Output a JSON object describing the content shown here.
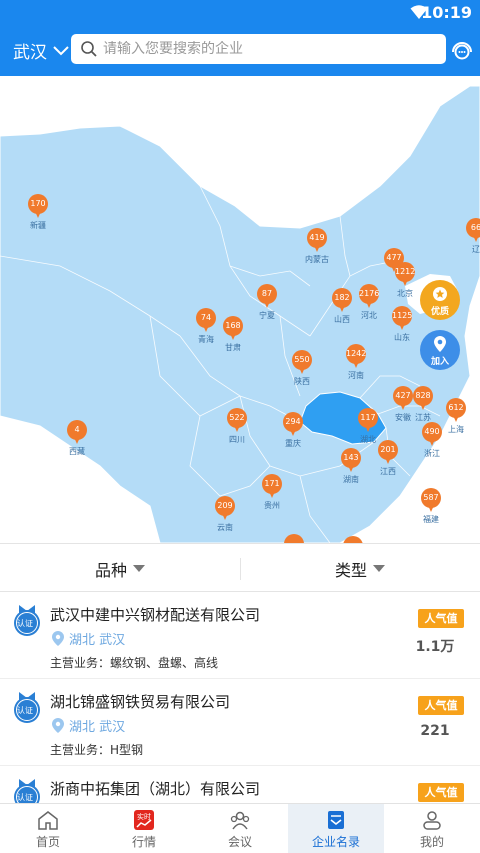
{
  "status": {
    "time": "10:19"
  },
  "header": {
    "city": "武汉",
    "search_placeholder": "请输入您要搜索的企业"
  },
  "map": {
    "pins": [
      {
        "value": "170",
        "label": "新疆"
      },
      {
        "value": "419",
        "label": "内蒙古"
      },
      {
        "value": "66",
        "label": "辽"
      },
      {
        "value": "477",
        "label": ""
      },
      {
        "value": "1212",
        "label": "北京"
      },
      {
        "value": "87",
        "label": "宁夏"
      },
      {
        "value": "182",
        "label": "山西"
      },
      {
        "value": "2176",
        "label": "河北"
      },
      {
        "value": "74",
        "label": "青海"
      },
      {
        "value": "168",
        "label": "甘肃"
      },
      {
        "value": "1125",
        "label": "山东"
      },
      {
        "value": "550",
        "label": "陕西"
      },
      {
        "value": "1242",
        "label": "河南"
      },
      {
        "value": "427",
        "label": "安徽"
      },
      {
        "value": "828",
        "label": "江苏"
      },
      {
        "value": "612",
        "label": "上海"
      },
      {
        "value": "522",
        "label": "四川"
      },
      {
        "value": "294",
        "label": "重庆"
      },
      {
        "value": "117",
        "label": "湖北"
      },
      {
        "value": "4",
        "label": "西藏"
      },
      {
        "value": "201",
        "label": "江西"
      },
      {
        "value": "490",
        "label": "浙江"
      },
      {
        "value": "143",
        "label": "湖南"
      },
      {
        "value": "171",
        "label": "贵州"
      },
      {
        "value": "209",
        "label": "云南"
      },
      {
        "value": "587",
        "label": "福建"
      }
    ],
    "quality_button": "优质",
    "join_button": "加入"
  },
  "filters": {
    "variety": "品种",
    "type": "类型"
  },
  "companies": [
    {
      "name": "武汉中建中兴钢材配送有限公司",
      "location": "湖北 武汉",
      "business": "主营业务：螺纹钢、盘螺、高线",
      "badge": "认证",
      "popularity_label": "人气值",
      "popularity": "1.1万"
    },
    {
      "name": "湖北锦盛钢铁贸易有限公司",
      "location": "湖北 武汉",
      "business": "主营业务：H型钢",
      "badge": "认证",
      "popularity_label": "人气值",
      "popularity": "221"
    },
    {
      "name": "浙商中拓集团（湖北）有限公司",
      "location": "",
      "business": "",
      "badge": "认证",
      "popularity_label": "人气值",
      "popularity": ""
    }
  ],
  "tabs": [
    {
      "label": "首页",
      "icon": "home-icon"
    },
    {
      "label": "行情",
      "icon": "market-icon",
      "tag": "实时"
    },
    {
      "label": "会议",
      "icon": "meeting-icon"
    },
    {
      "label": "企业名录",
      "icon": "directory-icon",
      "active": true
    },
    {
      "label": "我的",
      "icon": "profile-icon"
    }
  ],
  "colors": {
    "primary": "#1a87ee",
    "pin": "#f07a2c",
    "popularity": "#f7a21b",
    "map_land": "#b4dcf7",
    "hubei": "#2f9ff2"
  }
}
